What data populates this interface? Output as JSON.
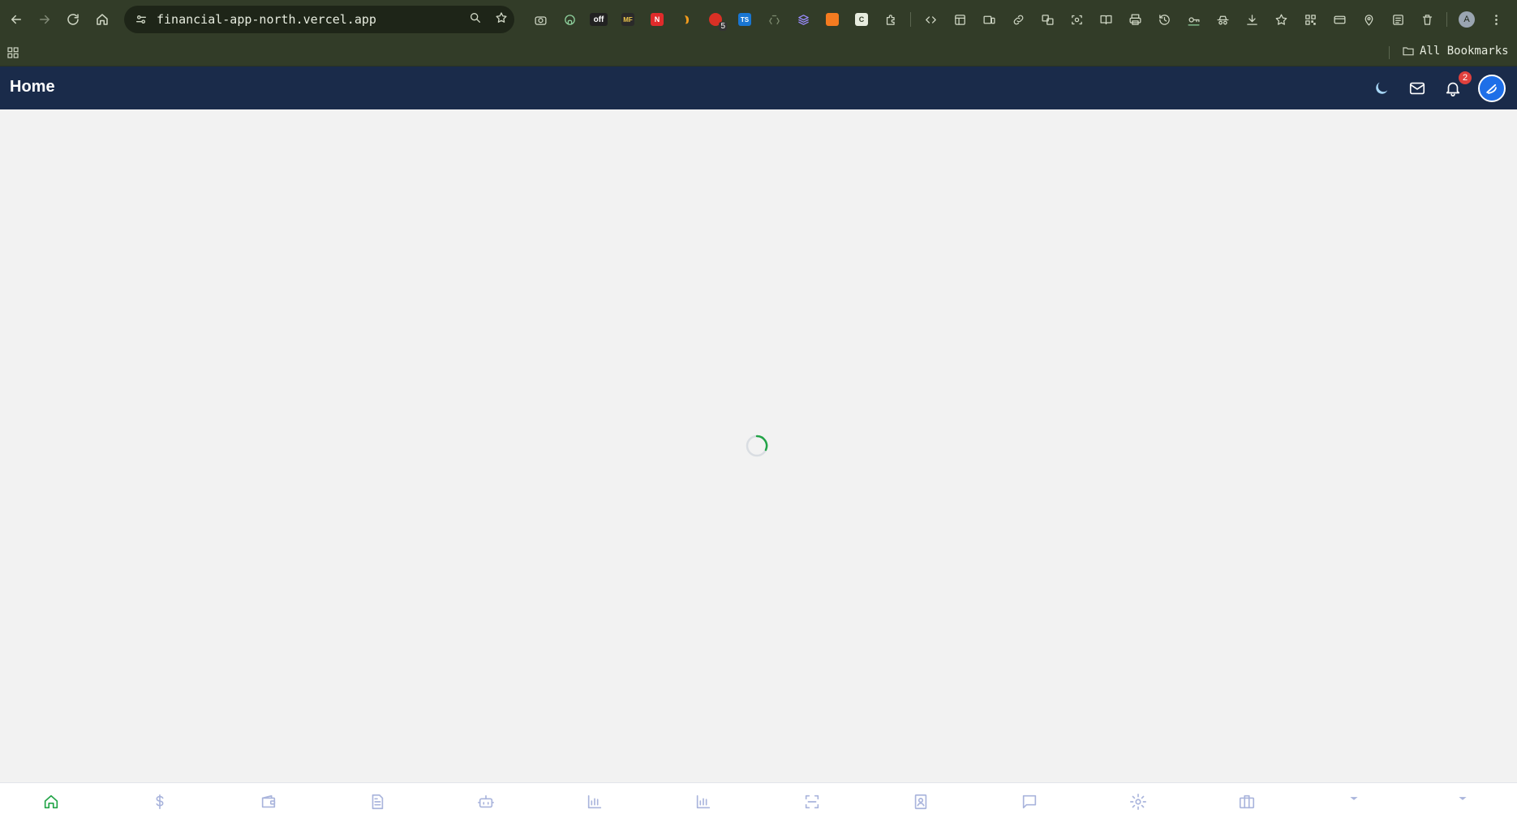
{
  "browser": {
    "url": "financial-app-north.vercel.app",
    "bookmarks_label": "All Bookmarks",
    "profile_initial": "A",
    "extensions": [
      {
        "name": "camera-icon"
      },
      {
        "name": "github-icon"
      },
      {
        "name": "off-extension-icon",
        "text": "off"
      },
      {
        "name": "mf-extension-icon",
        "text": "MF",
        "color": "#2a2a2a"
      },
      {
        "name": "red-n-extension-icon",
        "text": "N",
        "color": "#e02b2b"
      },
      {
        "name": "orange-extension-icon",
        "color": "#f29b1d"
      },
      {
        "name": "red-badge-extension-icon",
        "badge": "5",
        "color": "#d93025"
      },
      {
        "name": "ts-extension-icon",
        "text": "TS",
        "color": "#1976d2"
      }
    ]
  },
  "app": {
    "title": "Home",
    "notification_count": "2",
    "accent_color": "#1a2b4a",
    "active_color": "#22a447",
    "inactive_color": "#a9b4dc"
  },
  "bottom_nav": [
    {
      "name": "nav-home",
      "icon": "home-icon",
      "active": true
    },
    {
      "name": "nav-money",
      "icon": "dollar-icon",
      "active": false
    },
    {
      "name": "nav-wallet",
      "icon": "wallet-icon",
      "active": false
    },
    {
      "name": "nav-documents",
      "icon": "document-icon",
      "active": false
    },
    {
      "name": "nav-bot",
      "icon": "bot-icon",
      "active": false
    },
    {
      "name": "nav-chart-1",
      "icon": "bar-chart-icon",
      "active": false
    },
    {
      "name": "nav-chart-2",
      "icon": "bar-chart-icon",
      "active": false
    },
    {
      "name": "nav-scan",
      "icon": "scan-icon",
      "active": false
    },
    {
      "name": "nav-contacts",
      "icon": "contact-book-icon",
      "active": false
    },
    {
      "name": "nav-messages",
      "icon": "message-icon",
      "active": false
    },
    {
      "name": "nav-settings",
      "icon": "gear-icon",
      "active": false
    },
    {
      "name": "nav-business",
      "icon": "briefcase-icon",
      "active": false
    },
    {
      "name": "nav-more-1",
      "icon": "caret-down-icon",
      "active": false
    },
    {
      "name": "nav-more-2",
      "icon": "caret-down-icon",
      "active": false
    }
  ]
}
